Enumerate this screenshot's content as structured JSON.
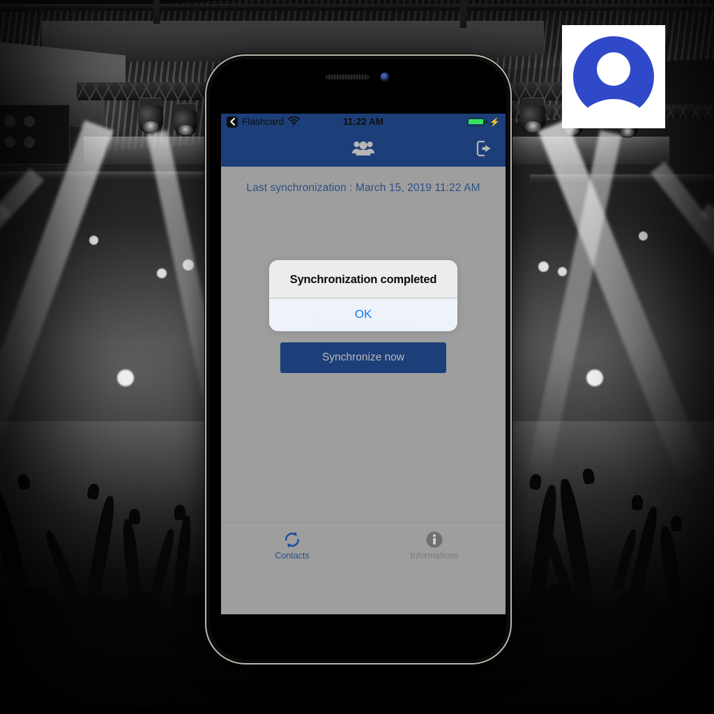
{
  "background": {
    "description": "black-and-white concert venue photo with stage lighting rigs, light beams and a crowd with raised hands"
  },
  "app_icon": {
    "name": "contact-avatar-logo",
    "background_color": "#ffffff",
    "shape_color": "#2f49c9"
  },
  "phone": {
    "device": "smartphone-mockup",
    "speaker_name": "earpiece-speaker",
    "camera_name": "front-camera"
  },
  "status_bar": {
    "back_label": "Flashcard",
    "back_icon": "back-chevron-icon",
    "wifi_icon": "wifi-icon",
    "time": "11:22 AM",
    "battery_icon": "battery-full-icon",
    "charging_icon": "charging-bolt-icon",
    "battery_color": "#34e35c",
    "background_color": "#1d3f79"
  },
  "nav_bar": {
    "title_icon": "contacts-group-icon",
    "logout_icon": "logout-icon",
    "background_color": "#1d3f79"
  },
  "content": {
    "last_sync_label": "Last synchronization : March 15, 2019 11:22 AM",
    "obscured_label": "Contacts synchronize",
    "sync_button_label": "Synchronize now",
    "background_color": "#9e9e9e",
    "accent_color": "#1d3f79"
  },
  "alert": {
    "title": "Synchronization completed",
    "ok_label": "OK",
    "ok_color": "#0a7bff"
  },
  "tab_bar": {
    "tabs": [
      {
        "label": "Contacts",
        "icon": "sync-refresh-icon",
        "active": true
      },
      {
        "label": "Informations",
        "icon": "info-circle-icon",
        "active": false
      }
    ]
  }
}
